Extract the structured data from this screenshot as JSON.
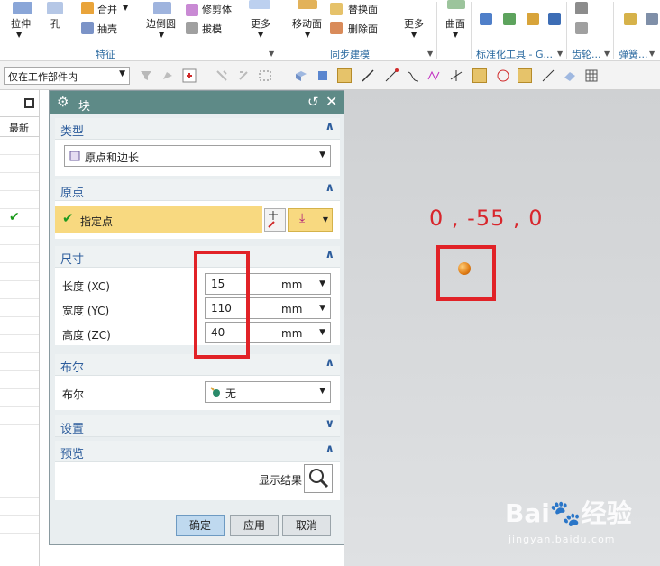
{
  "ribbon": {
    "items": {
      "extrude": "拉伸",
      "hole": "孔",
      "unite": "合并",
      "shell": "抽壳",
      "edge_blend": "边倒圆",
      "trim_body": "修剪体",
      "draft": "拔模",
      "more1": "更多",
      "move_face": "移动面",
      "replace_face": "替换面",
      "delete_face": "删除面",
      "more2": "更多",
      "surface": "曲面"
    },
    "groups": {
      "feature": "特征",
      "sync_modeling": "同步建模",
      "std_parts": "标准化工具 - G...",
      "gear": "齿轮...",
      "spring": "弹簧..."
    }
  },
  "toolbar": {
    "selection_filter": "仅在工作部件内"
  },
  "left_panel": {
    "column_header": "最新",
    "colors": {
      "check": "#1a9a1a"
    }
  },
  "dialog": {
    "title": "块",
    "type_section": {
      "label": "类型",
      "selected": "原点和边长"
    },
    "origin_section": {
      "label": "原点",
      "specify_point": "指定点"
    },
    "dimensions_section": {
      "label": "尺寸",
      "length_label": "长度 (XC)",
      "length_value": "15",
      "length_unit": "mm",
      "width_label": "宽度 (YC)",
      "width_value": "110",
      "width_unit": "mm",
      "height_label": "高度 (ZC)",
      "height_value": "40",
      "height_unit": "mm"
    },
    "boolean_section": {
      "label": "布尔",
      "field_label": "布尔",
      "selected": "无"
    },
    "settings_section": {
      "label": "设置"
    },
    "preview_section": {
      "label": "预览",
      "show_result": "显示结果"
    },
    "buttons": {
      "ok": "确定",
      "apply": "应用",
      "cancel": "取消"
    },
    "colors": {
      "title_bar": "#5e8a87",
      "section_label": "#2d5d9c",
      "highlight": "#f8d980"
    }
  },
  "graphics": {
    "coord_label": "0 , -55 , 0",
    "colors": {
      "annotation": "#e12227",
      "point": "#e07c14"
    }
  },
  "watermark": {
    "brand": "Bai",
    "brand2": "经验",
    "url": "jingyan.baidu.com"
  }
}
